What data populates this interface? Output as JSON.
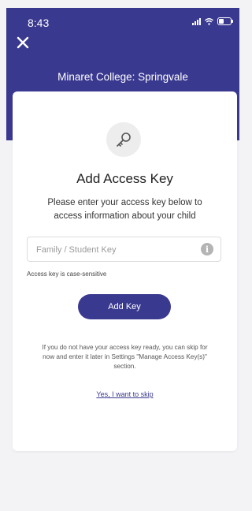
{
  "status_bar": {
    "time": "8:43"
  },
  "header": {
    "title": "Minaret College: Springvale",
    "close_icon": "close-icon"
  },
  "card": {
    "icon": "key-icon",
    "title": "Add Access Key",
    "instructions": "Please enter your access key below to access information about your child",
    "input": {
      "placeholder": "Family / Student Key",
      "value": ""
    },
    "hint": "Access key is case-sensitive",
    "add_button": "Add Key",
    "skip_text": "If you do not have your access key ready, you can skip for now and enter it later in Settings \"Manage Access Key(s)\" section.",
    "skip_link": "Yes, I want to skip"
  },
  "colors": {
    "brand": "#3a3990",
    "background": "#f3f3f6",
    "card": "#ffffff"
  }
}
